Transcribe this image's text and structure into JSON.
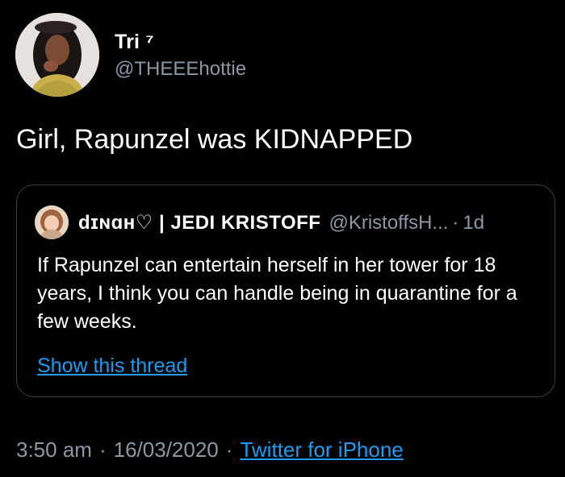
{
  "tweet": {
    "author": {
      "display_name": "Tri ⁷",
      "handle": "@THEEEhottie",
      "avatar_icon": "profile-photo-icon"
    },
    "text": "Girl, Rapunzel was KIDNAPPED",
    "quoted": {
      "display_name": "dɪɴɑʜ♡ | JEDI KRISTOFF",
      "handle": "@KristoffsH...",
      "separator": "·",
      "time": "1d",
      "text": "If Rapunzel can entertain herself in her tower for 18 years, I think you can handle being in quarantine for a few weeks.",
      "thread_link": "Show this thread",
      "avatar_icon": "profile-photo-icon"
    },
    "meta": {
      "time": "3:50 am",
      "separator": "·",
      "date": "16/03/2020",
      "source": "Twitter for iPhone"
    }
  },
  "colors": {
    "background": "#000000",
    "text_primary": "#ffffff",
    "text_secondary": "#8b98a5",
    "link": "#1d9bf0",
    "border": "#3a3f44"
  }
}
